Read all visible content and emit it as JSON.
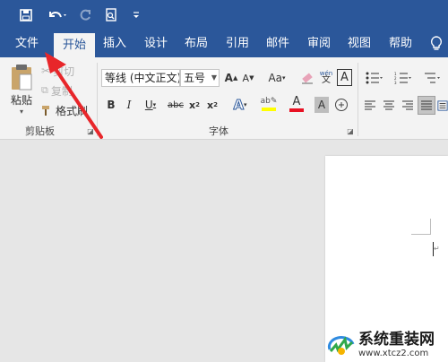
{
  "quick_access": {
    "save_icon": "save-icon",
    "undo_icon": "undo-icon",
    "redo_icon": "redo-icon",
    "print_preview_icon": "print-preview-icon",
    "customize_icon": "customize-qat-icon"
  },
  "menu": {
    "tabs": [
      "文件",
      "开始",
      "插入",
      "设计",
      "布局",
      "引用",
      "邮件",
      "审阅",
      "视图",
      "帮助"
    ],
    "active_index": 1,
    "help_icon": "lightbulb-icon"
  },
  "ribbon": {
    "clipboard": {
      "paste_label": "粘贴",
      "cut_label": "剪切",
      "copy_label": "复制",
      "format_painter_label": "格式刷",
      "group_label": "剪贴板"
    },
    "font": {
      "font_name": "等线 (中文正文)",
      "font_size": "五号",
      "group_label": "字体",
      "wen_label": "文",
      "a_label": "A"
    }
  },
  "watermark": {
    "title": "系统重装网",
    "url": "www.xtcz2.com"
  },
  "colors": {
    "title_bar": "#2b579a",
    "ribbon_bg": "#f3f3f3",
    "doc_bg": "#e6e6e6",
    "font_color_red": "#e81123",
    "highlight_yellow": "#ffff00",
    "arrow_red": "#e8262a"
  }
}
